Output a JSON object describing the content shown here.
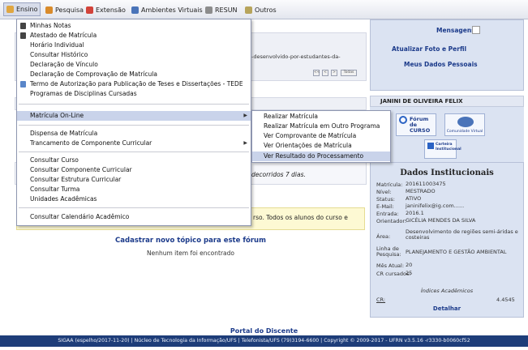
{
  "menu": {
    "items": [
      {
        "label": "Ensino",
        "icon": "ensino-icon"
      },
      {
        "label": "Pesquisa",
        "icon": "pesquisa-icon"
      },
      {
        "label": "Extensão",
        "icon": "extensao-icon"
      },
      {
        "label": "Ambientes Virtuais",
        "icon": "ambientes-icon"
      },
      {
        "label": "RESUN",
        "icon": "resun-icon"
      },
      {
        "label": "Outros",
        "icon": "outros-icon"
      }
    ]
  },
  "dropdown": {
    "items": [
      "Minhas Notas",
      "Atestado de Matrícula",
      "Horário Individual",
      "Consultar Histórico",
      "Declaração de Vínculo",
      "Declaração de Comprovação de Matrícula",
      "Termo de Autorização para Publicação de Teses e Dissertações - TEDE",
      "Programas de Disciplinas Cursadas",
      "Matrícula On-Line",
      "Dispensa de Matrícula",
      "Trancamento de Componente Curricular",
      "Consultar Curso",
      "Consultar Componente Curricular",
      "Consultar Estrutura Curricular",
      "Consultar Turma",
      "Unidades Acadêmicas",
      "Consultar Calendário Acadêmico"
    ]
  },
  "submenu": {
    "items": [
      "Realizar Matrícula",
      "Realizar Matrícula em Outro Programa",
      "Ver Comprovante de Matrícula",
      "Ver Orientações de Matrícula",
      "Ver Resultado do Processamento"
    ]
  },
  "main": {
    "path_text": "-desenvolvido-por-estudantes-da-",
    "pager": [
      "<<",
      "<",
      ">",
      "Todas"
    ],
    "decorridos": "decorridos 7 dias.",
    "notice": "rso. Todos os alunos do curso e",
    "forum_link": "Cadastrar novo tópico para este fórum",
    "forum_empty": "Nenhum item foi encontrado"
  },
  "panel": {
    "mensagens": "Mensagens",
    "atualizar": "Atualizar Foto e Perfil",
    "meus_dados": "Meus Dados Pessoais",
    "name": "JANINI DE OLIVEIRA FELIX",
    "forum_logo": "Fórum de CURSO",
    "comunidade": "Comunidade Virtual",
    "carteira": "Carteira Institucional",
    "dados_title": "Dados Institucionais",
    "fields": [
      {
        "label": "Matrícula:",
        "value": "201611003475"
      },
      {
        "label": "Nível:",
        "value": "MESTRADO"
      },
      {
        "label": "Status:",
        "value": "ATIVO"
      },
      {
        "label": "E-Mail:",
        "value": "janinifelix@ig.com......"
      },
      {
        "label": "Entrada:",
        "value": "2016.1"
      },
      {
        "label": "Orientador:",
        "value": "GICÉLIA MENDES DA SILVA"
      },
      {
        "label": "Área:",
        "value": "Desenvolvimento de regiões semi-áridas e costeiras"
      },
      {
        "label": "Linha de Pesquisa:",
        "value": "PLANEJAMENTO E GESTÃO AMBIENTAL"
      },
      {
        "label": "Mês Atual:",
        "value": "20"
      },
      {
        "label": "CR cursados:",
        "value": "25"
      }
    ],
    "indices_title": "Índices Acadêmicos",
    "cr_label": "CR:",
    "cr_value": "4.4545",
    "detalhar": "Detalhar"
  },
  "footer": {
    "portal": "Portal do Discente",
    "text": "SIGAA (espelho/2017-11-20) | Núcleo de Tecnologia da Informação/UFS | Telefonista/UFS (79)3194-6600 | Copyright © 2009-2017 - UFRN v3.5.16 -r3330-b0060cf52"
  },
  "colors": {
    "accent": "#1b3a8a",
    "footer": "#1e3d79",
    "highlight": "#c9d3ea",
    "panel": "#dbe3f2"
  }
}
